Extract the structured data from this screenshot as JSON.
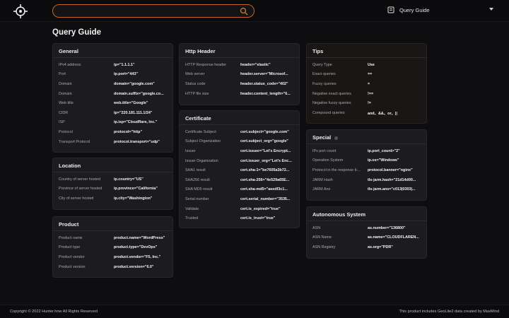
{
  "header": {
    "search_placeholder": "",
    "query_guide_label": "Query Guide"
  },
  "page_title": "Query Guide",
  "general": {
    "title": "General",
    "rows": [
      {
        "k": "IPv4 address",
        "v": "ip=\"1.1.1.1\""
      },
      {
        "k": "Port",
        "v": "ip.port=\"443\""
      },
      {
        "k": "Domain",
        "v": "domain=\"google.com\""
      },
      {
        "k": "Domain",
        "v": "domain.suffix=\"google.co..."
      },
      {
        "k": "Web title",
        "v": "web.title=\"Google\""
      },
      {
        "k": "CIDR",
        "v": "ip=\"220.181.111.1/24\""
      },
      {
        "k": "ISP",
        "v": "ip.isp=\"Cloudflare, Inc.\""
      },
      {
        "k": "Protocol",
        "v": "protocol=\"http\""
      },
      {
        "k": "Transport Protocol",
        "v": "protocol.transport=\"udp\""
      }
    ]
  },
  "location": {
    "title": "Location",
    "rows": [
      {
        "k": "Country of server hosted",
        "v": "ip.country=\"US\""
      },
      {
        "k": "Province of server hosted",
        "v": "ip.province=\"California\""
      },
      {
        "k": "City of server hosted",
        "v": "ip.city=\"Washington\""
      }
    ]
  },
  "product": {
    "title": "Product",
    "rows": [
      {
        "k": "Product name",
        "v": "product.name=\"WordPress\""
      },
      {
        "k": "Product type",
        "v": "product.type=\"DevOps\""
      },
      {
        "k": "Product vendor",
        "v": "product.vendor=\"F5, Inc.\""
      },
      {
        "k": "Product version",
        "v": "product.version=\"6.0\""
      }
    ]
  },
  "http_header": {
    "title": "Http Header",
    "rows": [
      {
        "k": "HTTP Response header",
        "v": "header=\"elastic\""
      },
      {
        "k": "Web server",
        "v": "header.server=\"Microsof..."
      },
      {
        "k": "Status code",
        "v": "header.status_code=\"402\""
      },
      {
        "k": "HTTP file size",
        "v": "header.content_length=\"6..."
      }
    ]
  },
  "certificate": {
    "title": "Certificate",
    "rows": [
      {
        "k": "Certificate Subject",
        "v": "cert.subject=\"google.com\""
      },
      {
        "k": "Subject Organization",
        "v": "cert.subject_org=\"google\""
      },
      {
        "k": "Issuer",
        "v": "cert.issuer=\"Let's Encrypt..."
      },
      {
        "k": "Issuer Organization",
        "v": "cert.issuer_org=\"Let's Enc..."
      },
      {
        "k": "SHA1 result",
        "v": "cert.sha-1=\"be7605a3b72..."
      },
      {
        "k": "SHA256 result",
        "v": "cert.sha-256=\"4e529a65E..."
      },
      {
        "k": "SHA MD5 result",
        "v": "cert.sha-md5=\"aeedf3c1..."
      },
      {
        "k": "Serial number",
        "v": "cert.serial_number=\"3535..."
      },
      {
        "k": "Validate",
        "v": "cert.is_expired=\"true\""
      },
      {
        "k": "Trusted",
        "v": "cert.is_trust=\"true\""
      }
    ]
  },
  "tips": {
    "title": "Tips",
    "rows": [
      {
        "k": "Query Type",
        "v": "Use"
      },
      {
        "k": "Exact queries",
        "v": "=="
      },
      {
        "k": "Fuzzy queries",
        "v": "="
      },
      {
        "k": "Negative exact queries",
        "v": "!=="
      },
      {
        "k": "Negative fuzzy queries",
        "v": "!="
      },
      {
        "k": "Compound queries",
        "v": "and、&&、or、||"
      }
    ]
  },
  "special": {
    "title": "Special",
    "rows": [
      {
        "k": "IPs port count",
        "v": "ip.port_count>\"2\""
      },
      {
        "k": "Operation System",
        "v": "ip.os=\"Windows\""
      },
      {
        "k": "Protocol in the response b...",
        "v": "protocol.banner=\"nginx\""
      },
      {
        "k": "JARM Hash",
        "v": "tls-jarm.hash=\"21d14d00..."
      },
      {
        "k": "JARM Ans",
        "v": "tls-jarm.ans=\"c013|0303|..."
      }
    ]
  },
  "autonomous_system": {
    "title": "Autonomous System",
    "rows": [
      {
        "k": "ASN",
        "v": "as.number=\"136800\""
      },
      {
        "k": "ASN Name",
        "v": "as.name=\"CLOUDFLAREN..."
      },
      {
        "k": "ASN Registry",
        "v": "as.org=\"PDR\""
      }
    ]
  },
  "footer": {
    "left": "Copyright © 2022 Hunter.how All Rights Reserved",
    "right": "This product includes GeoLite2 data created by MaxMind"
  }
}
